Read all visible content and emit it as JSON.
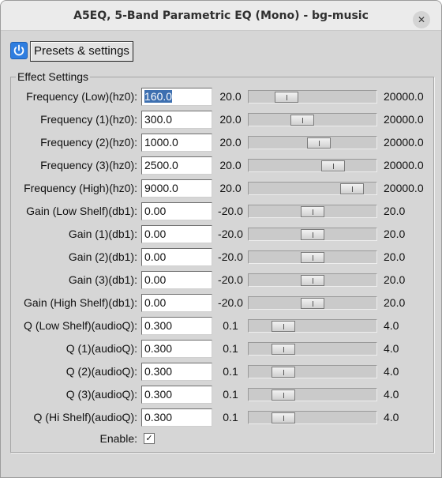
{
  "window": {
    "title": "A5EQ, 5-Band Parametric EQ (Mono) - bg-music",
    "close_symbol": "✕"
  },
  "toolbar": {
    "presets_label": "Presets & settings",
    "power_icon": "power-icon"
  },
  "group": {
    "title": "Effect Settings"
  },
  "params": [
    {
      "label": "Frequency (Low)(hz0):",
      "value": "160.0",
      "min": "20.0",
      "max": "20000.0",
      "level": 0.25,
      "selected": true
    },
    {
      "label": "Frequency (1)(hz0):",
      "value": "300.0",
      "min": "20.0",
      "max": "20000.0",
      "level": 0.4
    },
    {
      "label": "Frequency (2)(hz0):",
      "value": "1000.0",
      "min": "20.0",
      "max": "20000.0",
      "level": 0.56
    },
    {
      "label": "Frequency (3)(hz0):",
      "value": "2500.0",
      "min": "20.0",
      "max": "20000.0",
      "level": 0.7
    },
    {
      "label": "Frequency (High)(hz0):",
      "value": "9000.0",
      "min": "20.0",
      "max": "20000.0",
      "level": 0.88
    },
    {
      "label": "Gain (Low Shelf)(db1):",
      "value": "0.00",
      "min": "-20.0",
      "max": "20.0",
      "level": 0.5
    },
    {
      "label": "Gain (1)(db1):",
      "value": "0.00",
      "min": "-20.0",
      "max": "20.0",
      "level": 0.5
    },
    {
      "label": "Gain (2)(db1):",
      "value": "0.00",
      "min": "-20.0",
      "max": "20.0",
      "level": 0.5
    },
    {
      "label": "Gain (3)(db1):",
      "value": "0.00",
      "min": "-20.0",
      "max": "20.0",
      "level": 0.5
    },
    {
      "label": "Gain (High Shelf)(db1):",
      "value": "0.00",
      "min": "-20.0",
      "max": "20.0",
      "level": 0.5
    },
    {
      "label": "Q (Low Shelf)(audioQ):",
      "value": "0.300",
      "min": "0.1",
      "max": "4.0",
      "level": 0.22
    },
    {
      "label": "Q (1)(audioQ):",
      "value": "0.300",
      "min": "0.1",
      "max": "4.0",
      "level": 0.22
    },
    {
      "label": "Q (2)(audioQ):",
      "value": "0.300",
      "min": "0.1",
      "max": "4.0",
      "level": 0.22
    },
    {
      "label": "Q (3)(audioQ):",
      "value": "0.300",
      "min": "0.1",
      "max": "4.0",
      "level": 0.22
    },
    {
      "label": "Q (Hi Shelf)(audioQ):",
      "value": "0.300",
      "min": "0.1",
      "max": "4.0",
      "level": 0.22
    }
  ],
  "enable": {
    "label": "Enable:",
    "checked": true,
    "check_symbol": "✓"
  },
  "colors": {
    "accent": "#2f7ee0",
    "selection": "#3d6fb0",
    "window_bg": "#d6d6d6"
  }
}
